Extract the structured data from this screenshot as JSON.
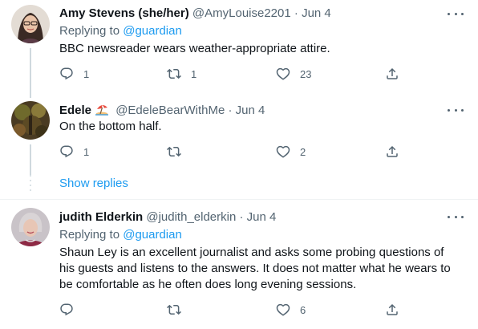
{
  "tweets": [
    {
      "name": "Amy Stevens (she/her)",
      "handle": "@AmyLouise2201",
      "separator": "·",
      "date": "Jun 4",
      "replying_prefix": "Replying to",
      "replying_to": "@guardian",
      "text": "BBC newsreader wears weather-appropriate attire.",
      "replies": "1",
      "retweets": "1",
      "likes": "23"
    },
    {
      "name": "Edele",
      "name_emoji": "beach-umbrella-icon",
      "handle": "@EdeleBearWithMe",
      "separator": "·",
      "date": "Jun 4",
      "text": "On the bottom half.",
      "replies": "1",
      "retweets": "",
      "likes": "2",
      "show_replies": "Show replies"
    },
    {
      "name": "judith Elderkin",
      "handle": "@judith_elderkin",
      "separator": "·",
      "date": "Jun 4",
      "replying_prefix": "Replying to",
      "replying_to": "@guardian",
      "text": "Shaun Ley is an excellent journalist and asks some probing questions of his guests and listens to the answers. It does not matter what he wears to be comfortable as he often does long evening sessions.",
      "replies": "",
      "retweets": "",
      "likes": "6"
    }
  ],
  "colors": {
    "link": "#1d9bf0",
    "secondary_text": "#536471",
    "primary_text": "#0f1419",
    "thread_line": "#cfd9de"
  }
}
